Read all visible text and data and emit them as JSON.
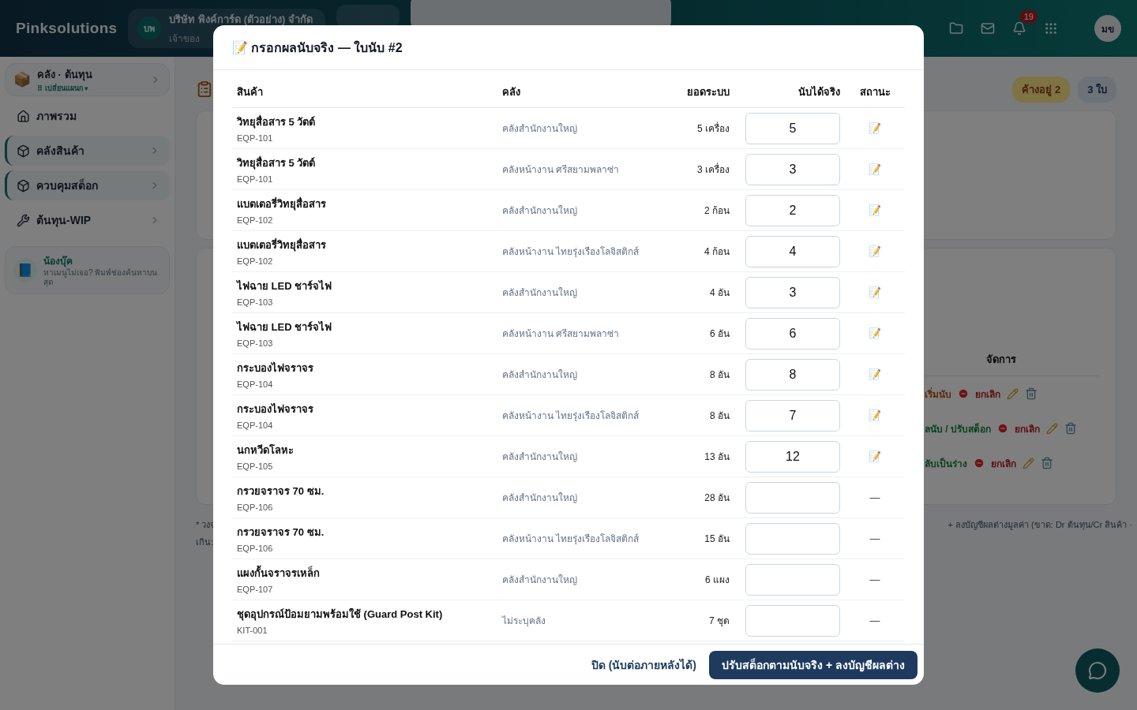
{
  "header": {
    "logo": "Pinksolutions",
    "company": {
      "initials": "บพ",
      "name": "บริษัท พิงค์การ์ด (ตัวอย่าง) จำกัด",
      "role": "เจ้าของ"
    },
    "notifications": "19",
    "user_initials": "มข"
  },
  "sidebar": {
    "department": {
      "icon": "📦",
      "title": "คลัง · ต้นทุน",
      "switch": "⠿ เปลี่ยนแผนก ▾"
    },
    "items": [
      {
        "label": "ภาพรวม",
        "selected": false
      },
      {
        "label": "คลังสินค้า",
        "selected": true
      },
      {
        "label": "ควบคุมสต็อก",
        "selected": true
      },
      {
        "label": "ต้นทุน-WIP",
        "selected": false
      }
    ],
    "helper": {
      "icon": "📘",
      "name": "น้องบุ๊ค",
      "hint": "หาเมนูไม่เจอ? พิมพ์ช่องค้นหาบนสุด"
    }
  },
  "background": {
    "badges": [
      {
        "label": "ค้างอยู่ 2",
        "kind": "warning"
      },
      {
        "label": "3 ใบ",
        "kind": "info"
      }
    ],
    "actions_heading": "จัดการ",
    "action_rows": [
      {
        "primary": "เริ่มนับ",
        "kind": "warning",
        "cancel": "ยกเลิก"
      },
      {
        "primary": "ลนับ / ปรับสต็อก",
        "kind": "success",
        "cancel": "ยกเลิก"
      },
      {
        "primary": "ลับเป็นร่าง",
        "kind": "success",
        "cancel": "ยกเลิก"
      }
    ],
    "note_left": [
      "* วงจ",
      "เกิน:"
    ],
    "note_right": "+ ลงบัญชีผลต่างมูลค่า (ขาด: Dr ต้นทุน/Cr สินค้า ·"
  },
  "modal": {
    "title": "📝 กรอกผลนับจริง — ใบนับ #2",
    "columns": [
      "สินค้า",
      "คลัง",
      "ยอดระบบ",
      "นับได้จริง",
      "สถานะ"
    ],
    "rows": [
      {
        "name": "วิทยุสื่อสาร 5 วัตต์",
        "sku": "EQP-101",
        "warehouse": "คลังสำนักงานใหญ่",
        "system": "5 เครื่อง",
        "counted": "5",
        "status": "📝"
      },
      {
        "name": "วิทยุสื่อสาร 5 วัตต์",
        "sku": "EQP-101",
        "warehouse": "คลังหน้างาน ศรีสยามพลาซ่า",
        "system": "3 เครื่อง",
        "counted": "3",
        "status": "📝"
      },
      {
        "name": "แบตเตอรี่วิทยุสื่อสาร",
        "sku": "EQP-102",
        "warehouse": "คลังสำนักงานใหญ่",
        "system": "2 ก้อน",
        "counted": "2",
        "status": "📝"
      },
      {
        "name": "แบตเตอรี่วิทยุสื่อสาร",
        "sku": "EQP-102",
        "warehouse": "คลังหน้างาน ไทยรุ่งเรืองโลจิสติกส์",
        "system": "4 ก้อน",
        "counted": "4",
        "status": "📝"
      },
      {
        "name": "ไฟฉาย LED ชาร์จไฟ",
        "sku": "EQP-103",
        "warehouse": "คลังสำนักงานใหญ่",
        "system": "4 อัน",
        "counted": "3",
        "status": "📝"
      },
      {
        "name": "ไฟฉาย LED ชาร์จไฟ",
        "sku": "EQP-103",
        "warehouse": "คลังหน้างาน ศรีสยามพลาซ่า",
        "system": "6 อัน",
        "counted": "6",
        "status": "📝"
      },
      {
        "name": "กระบองไฟจราจร",
        "sku": "EQP-104",
        "warehouse": "คลังสำนักงานใหญ่",
        "system": "8 อัน",
        "counted": "8",
        "status": "📝"
      },
      {
        "name": "กระบองไฟจราจร",
        "sku": "EQP-104",
        "warehouse": "คลังหน้างาน ไทยรุ่งเรืองโลจิสติกส์",
        "system": "8 อัน",
        "counted": "7",
        "status": "📝"
      },
      {
        "name": "นกหวีดโลหะ",
        "sku": "EQP-105",
        "warehouse": "คลังสำนักงานใหญ่",
        "system": "13 อัน",
        "counted": "12",
        "status": "📝"
      },
      {
        "name": "กรวยจราจร 70 ซม.",
        "sku": "EQP-106",
        "warehouse": "คลังสำนักงานใหญ่",
        "system": "28 อัน",
        "status": "—"
      },
      {
        "name": "กรวยจราจร 70 ซม.",
        "sku": "EQP-106",
        "warehouse": "คลังหน้างาน ไทยรุ่งเรืองโลจิสติกส์",
        "system": "15 อัน",
        "status": "—"
      },
      {
        "name": "แผงกั้นจราจรเหล็ก",
        "sku": "EQP-107",
        "warehouse": "คลังสำนักงานใหญ่",
        "system": "6 แผง",
        "status": "—"
      },
      {
        "name": "ชุดอุปกรณ์ป้อมยามพร้อมใช้ (Guard Post Kit)",
        "sku": "KIT-001",
        "warehouse": "ไม่ระบุคลัง",
        "system": "7 ชุด",
        "status": "—"
      }
    ],
    "close_button": "ปิด (นับต่อภายหลังได้)",
    "confirm_button": "ปรับสต็อกตามนับจริง + ลงบัญชีผลต่าง"
  }
}
